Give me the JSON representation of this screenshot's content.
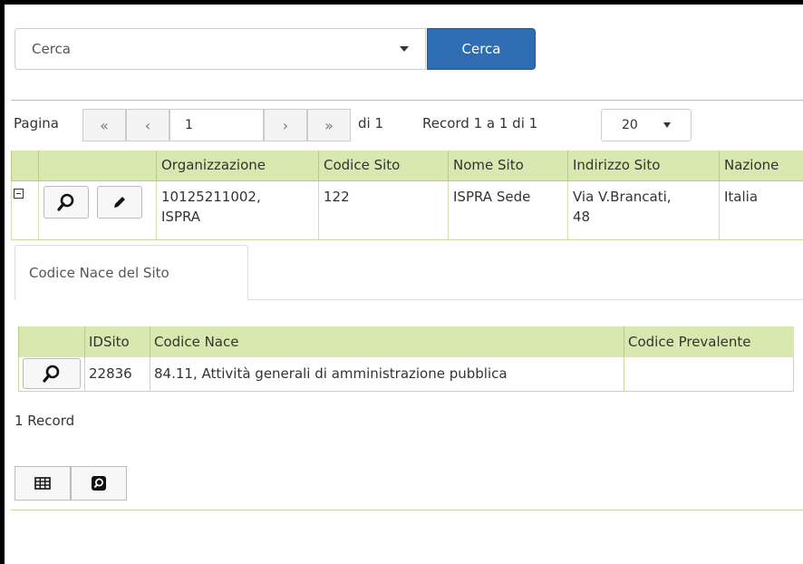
{
  "search": {
    "placeholder": "Cerca",
    "button_label": "Cerca"
  },
  "pager": {
    "label": "Pagina",
    "first": "«",
    "prev": "‹",
    "page_value": "1",
    "next": "›",
    "last": "»",
    "of_label": "di 1",
    "record_info": "Record 1 a 1 di 1",
    "page_size": "20"
  },
  "grid": {
    "columns": [
      "Organizzazione",
      "Codice Sito",
      "Nome Sito",
      "Indirizzo Sito",
      "Nazione"
    ],
    "rows": [
      {
        "organizzazione_line1": "10125211002,",
        "organizzazione_line2": "ISPRA",
        "codice_sito": "122",
        "nome_sito": "ISPRA Sede",
        "indirizzo_line1": "Via V.Brancati,",
        "indirizzo_line2": "48",
        "nazione": "Italia"
      }
    ]
  },
  "detail": {
    "tab_label": "Codice Nace del Sito",
    "columns": [
      "IDSito",
      "Codice Nace",
      "Codice Prevalente"
    ],
    "rows": [
      {
        "idsito": "22836",
        "codice_nace": "84.11, Attività generali di amministrazione pubblica",
        "codice_prevalente": ""
      }
    ],
    "record_count": "1 Record"
  },
  "icons": {
    "search": "magnifier-icon",
    "edit": "pencil-icon",
    "grid": "table-icon",
    "zoom": "zoom-icon"
  },
  "colors": {
    "primary_button": "#2f6db3",
    "header_bg": "#d9e8ae"
  }
}
